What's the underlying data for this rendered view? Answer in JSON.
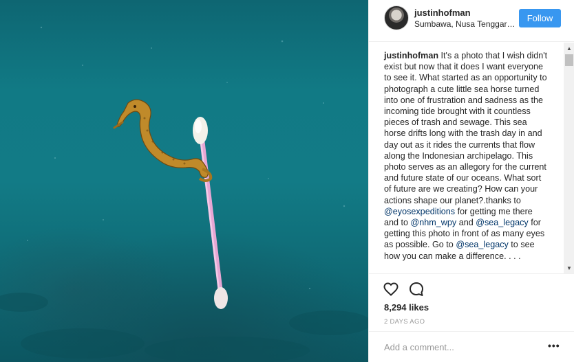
{
  "post": {
    "username": "justinhofman",
    "location": "Sumbawa, Nusa Tenggara Barat",
    "follow_label": "Follow"
  },
  "caption": {
    "username": "justinhofman",
    "text_1": " It's a photo that I wish didn't exist but now that it does I want everyone to see it. What started as an opportunity to photograph a cute little sea horse turned into one of frustration and sadness as the incoming tide brought with it countless pieces of trash and sewage. This sea horse drifts long with the trash day in and day out as it rides the currents that flow along the Indonesian archipelago. This photo serves as an allegory for the current and future state of our oceans. What sort of future are we creating? How can your actions shape our planet?.thanks to ",
    "mention_1": "@eyosexpeditions",
    "text_2": " for getting me there and to ",
    "mention_2": "@nhm_wpy",
    "text_3": " and ",
    "mention_3": "@sea_legacy",
    "text_4": " for getting this photo in front of as many eyes as possible. Go to ",
    "mention_4": "@sea_legacy",
    "text_5": " to see how you can make a difference. . . ."
  },
  "stats": {
    "likes": "8,294 likes",
    "time": "2 DAYS AGO"
  },
  "comment_box": {
    "placeholder": "Add a comment...",
    "more_label": "•••"
  },
  "icons": {
    "like": "heart-icon",
    "comment": "comment-bubble-icon",
    "avatar": "user-avatar",
    "scroll_up": "chevron-up-icon",
    "scroll_down": "chevron-down-icon"
  },
  "colors": {
    "accent": "#3897f0",
    "mention": "#003569",
    "ocean": "#117a85"
  }
}
